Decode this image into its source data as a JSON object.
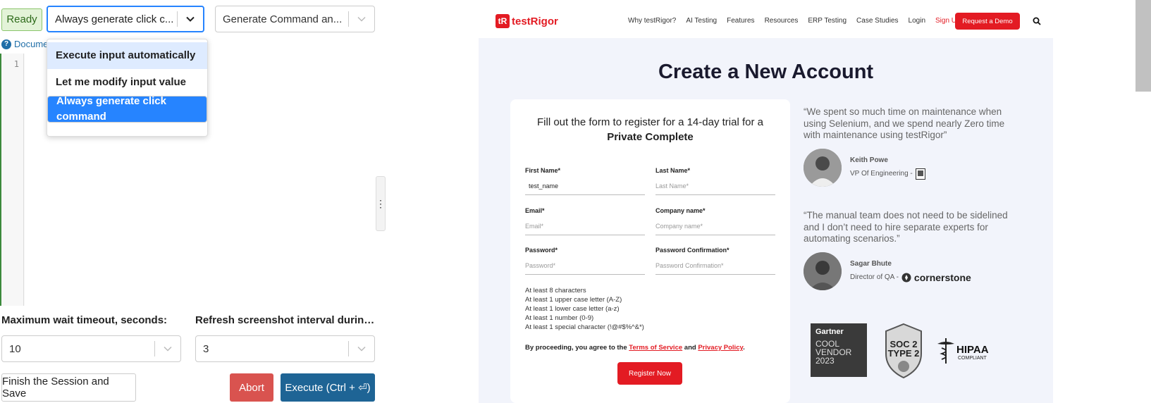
{
  "left_panel": {
    "status": "Ready",
    "mode_select": {
      "value": "Always generate click c..."
    },
    "command_select": {
      "value": "Generate Command an..."
    },
    "documentation_link": "Docume",
    "editor": {
      "line_numbers": [
        "1"
      ]
    },
    "mode_menu": {
      "options": [
        "Execute input automatically",
        "Let me modify input value",
        "Always generate click command"
      ],
      "highlighted_index": 0,
      "selected_index": 2
    },
    "wait_timeout": {
      "label": "Maximum wait timeout, seconds:",
      "value": "10"
    },
    "refresh_interval": {
      "label": "Refresh screenshot interval during i...",
      "value": "3"
    },
    "buttons": {
      "finish": "Finish the Session and Save",
      "abort": "Abort",
      "execute": "Execute (Ctrl + ⏎)"
    },
    "colors": {
      "status_bg": "#e3f3d8",
      "abort": "#d9534f",
      "execute": "#1e6495",
      "menu_selected": "#2684ff",
      "menu_hover": "#deebff"
    }
  },
  "browser": {
    "nav": {
      "logo_mark": "tR",
      "logo_text": "testRigor",
      "links": [
        "Why testRigor?",
        "AI Testing",
        "Features",
        "Resources",
        "ERP Testing",
        "Case Studies",
        "Login",
        "Sign Up"
      ],
      "demo_button": "Request a Demo"
    },
    "heading": "Create a New Account",
    "form": {
      "intro_line1": "Fill out the form to register for a 14-day trial for a",
      "intro_line2": "Private Complete",
      "fields": [
        {
          "label": "First Name*",
          "value": "test_name",
          "placeholder": ""
        },
        {
          "label": "Last Name*",
          "value": "",
          "placeholder": "Last Name*"
        },
        {
          "label": "Email*",
          "value": "",
          "placeholder": "Email*"
        },
        {
          "label": "Company name*",
          "value": "",
          "placeholder": "Company name*"
        },
        {
          "label": "Password*",
          "value": "",
          "placeholder": "Password*"
        },
        {
          "label": "Password Confirmation*",
          "value": "",
          "placeholder": "Password Confirmation*"
        }
      ],
      "rules": [
        "At least 8 characters",
        "At least 1 upper case letter (A-Z)",
        "At least 1 lower case letter (a-z)",
        "At least 1 number (0-9)",
        "At least 1 special character (!@#$%^&*)"
      ],
      "agree_prefix": "By proceeding, you agree to the",
      "terms": "Terms of Service",
      "and": "and",
      "privacy": "Privacy Policy",
      "agree_suffix": ".",
      "register_button": "Register Now"
    },
    "testimonials": [
      {
        "quote": "“We spent so much time on maintenance when using Selenium, and we spend nearly Zero time with maintenance using testRigor”",
        "name": "Keith Powe",
        "title": "VP Of Engineering -"
      },
      {
        "quote": "“The manual team does not need to be sidelined and I don’t need to hire separate experts for automating scenarios.”",
        "name": "Sagar Bhute",
        "title": "Director of QA -",
        "company": "cornerstone"
      }
    ],
    "badges": {
      "gartner": {
        "brand": "Gartner",
        "line1": "COOL",
        "line2": "VENDOR",
        "line3": "2023"
      },
      "soc": {
        "line1": "SOC 2",
        "line2": "TYPE 2"
      },
      "hipaa": {
        "line1": "HIPAA",
        "line2": "COMPLIANT"
      }
    },
    "colors": {
      "brand_red": "#e31b23",
      "page_bg": "#f2f4fb"
    }
  }
}
